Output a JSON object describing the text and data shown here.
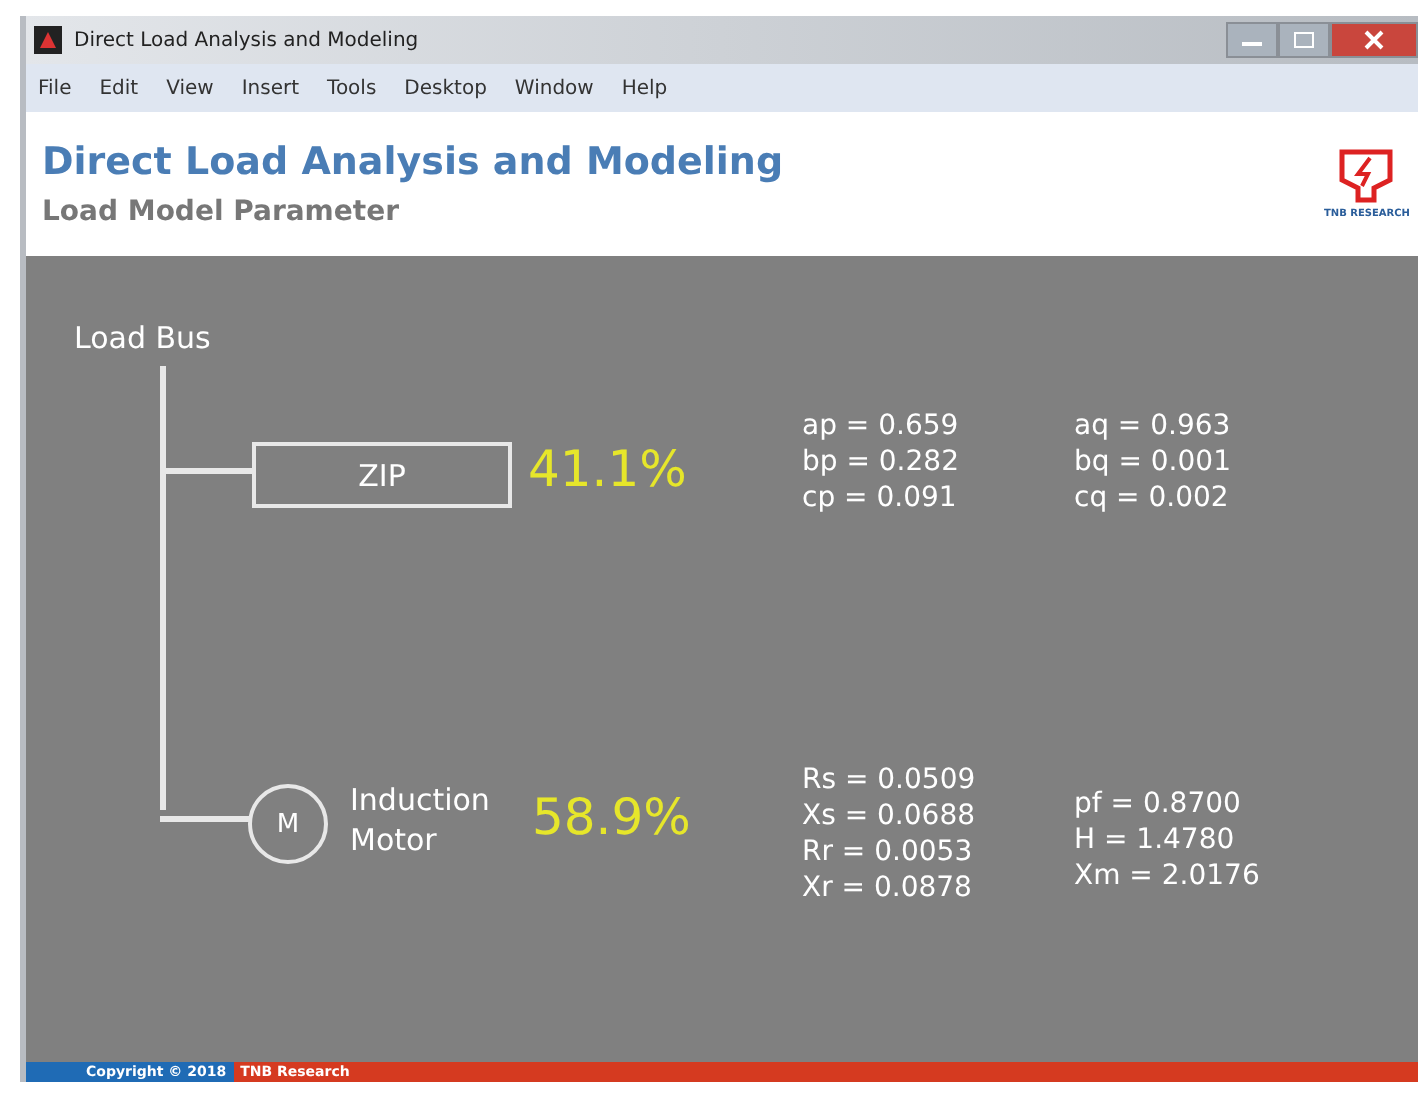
{
  "window": {
    "title": "Direct Load Analysis and Modeling"
  },
  "menu": [
    "File",
    "Edit",
    "View",
    "Insert",
    "Tools",
    "Desktop",
    "Window",
    "Help"
  ],
  "header": {
    "title": "Direct Load Analysis and Modeling",
    "subtitle": "Load Model Parameter",
    "logo_text": "TNB RESEARCH"
  },
  "diagram": {
    "bus_label": "Load Bus",
    "zip": {
      "label": "ZIP",
      "percent": "41.1%",
      "params_left": [
        "ap = 0.659",
        "bp = 0.282",
        "cp = 0.091"
      ],
      "params_right": [
        "aq = 0.963",
        "bq = 0.001",
        "cq = 0.002"
      ]
    },
    "motor": {
      "symbol": "M",
      "label": "Induction Motor",
      "percent": "58.9%",
      "params_left": [
        "Rs = 0.0509",
        "Xs = 0.0688",
        "Rr = 0.0053",
        "Xr = 0.0878"
      ],
      "params_right": [
        "pf = 0.8700",
        "H = 1.4780",
        "Xm = 2.0176"
      ]
    }
  },
  "footer": {
    "copyright": "Copyright © 2018",
    "company": "TNB Research"
  }
}
